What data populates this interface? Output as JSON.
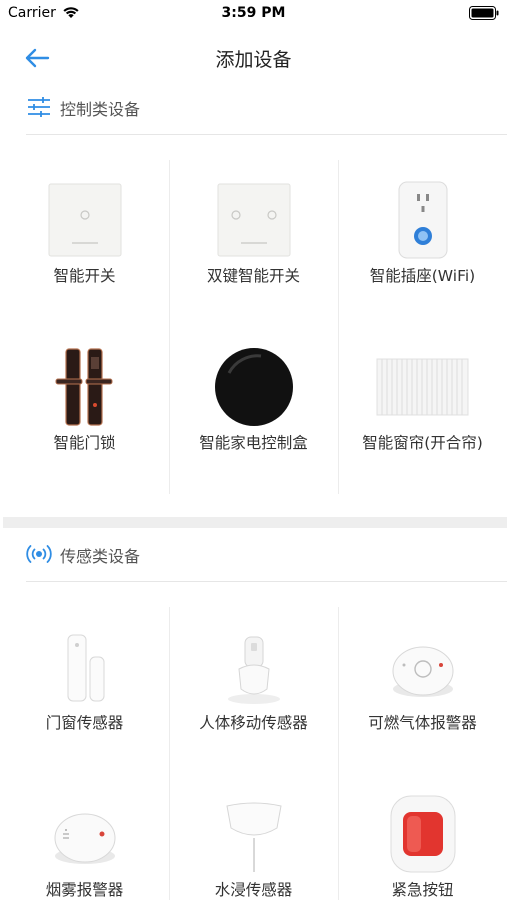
{
  "status_bar": {
    "carrier": "Carrier",
    "time": "3:59 PM"
  },
  "nav": {
    "title": "添加设备",
    "back_icon": "arrow-left-icon"
  },
  "sections": [
    {
      "title": "控制类设备",
      "icon": "sliders-icon",
      "accent": "#2f8de4",
      "devices": [
        {
          "name": "智能开关",
          "icon": "smart-switch-icon"
        },
        {
          "name": "双键智能开关",
          "icon": "double-key-switch-icon"
        },
        {
          "name": "智能插座(WiFi)",
          "icon": "smart-socket-icon"
        },
        {
          "name": "智能门锁",
          "icon": "smart-door-lock-icon"
        },
        {
          "name": "智能家电控制盒",
          "icon": "appliance-control-box-icon"
        },
        {
          "name": "智能窗帘(开合帘)",
          "icon": "smart-curtain-icon"
        }
      ]
    },
    {
      "title": "传感类设备",
      "icon": "signal-waves-icon",
      "accent": "#2f8de4",
      "devices": [
        {
          "name": "门窗传感器",
          "icon": "door-window-sensor-icon"
        },
        {
          "name": "人体移动传感器",
          "icon": "motion-sensor-icon"
        },
        {
          "name": "可燃气体报警器",
          "icon": "gas-alarm-icon"
        },
        {
          "name": "烟雾报警器",
          "icon": "smoke-alarm-icon"
        },
        {
          "name": "水浸传感器",
          "icon": "water-leak-sensor-icon"
        },
        {
          "name": "紧急按钮",
          "icon": "emergency-button-icon"
        }
      ]
    }
  ]
}
